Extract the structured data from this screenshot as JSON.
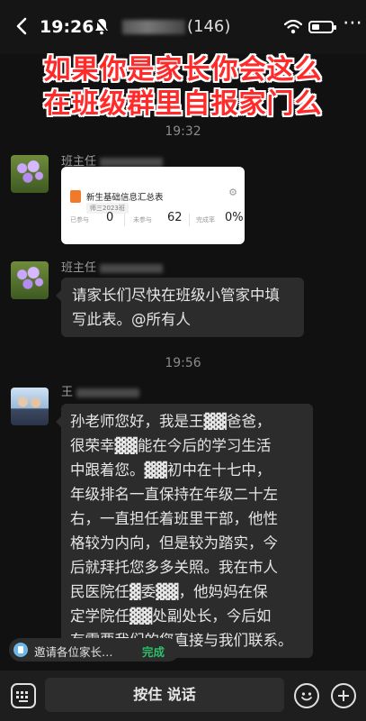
{
  "status_bar": {
    "time": "19:26",
    "icons": [
      "bell-muted-icon",
      "wifi-icon",
      "battery-icon"
    ]
  },
  "header": {
    "title_count": "(146)",
    "back_icon": "chevron-left-icon",
    "more_icon": "more-icon"
  },
  "caption": {
    "line1": "如果你是家长你会这么",
    "line2": "在班级群里自报家门么",
    "color": "#ff2a2a"
  },
  "messages": {
    "ts1": "19:32",
    "m1_sender": "班主任",
    "form_card": {
      "title": "新生基础信息汇总表",
      "tag": "师三2023班",
      "done_label": "已参与",
      "done_value": "0",
      "todo_label": "未参与",
      "todo_value": "62",
      "rate_label": "完成率",
      "rate_value": "0%"
    },
    "m2_sender": "班主任",
    "m2_text": "请家长们尽快在班级小管家中填写此表。@所有人",
    "ts2": "19:56",
    "m3_sender": "王",
    "m3_lines": [
      "孙老师您好，我是王▓▓爸爸，",
      "很荣幸▓▓能在今后的学习生活",
      "中跟着您。▓▓初中在十七中，",
      "年级排名一直保持在年级二十左",
      "右，一直担任着班里干部，他性",
      "格较为内向，但是较为踏实，今",
      "后就拜托您多多关照。我在市人",
      "民医院任▓委▓▓，他妈妈在保",
      "定学院任▓▓处副处长，今后如",
      "有需要我们的您直接与我们联系。"
    ]
  },
  "composer": {
    "invite_text": "邀请各位家长…",
    "invite_status": "完成",
    "hold_to_talk": "按住 说话",
    "accent_green": "#2bbf6a"
  }
}
